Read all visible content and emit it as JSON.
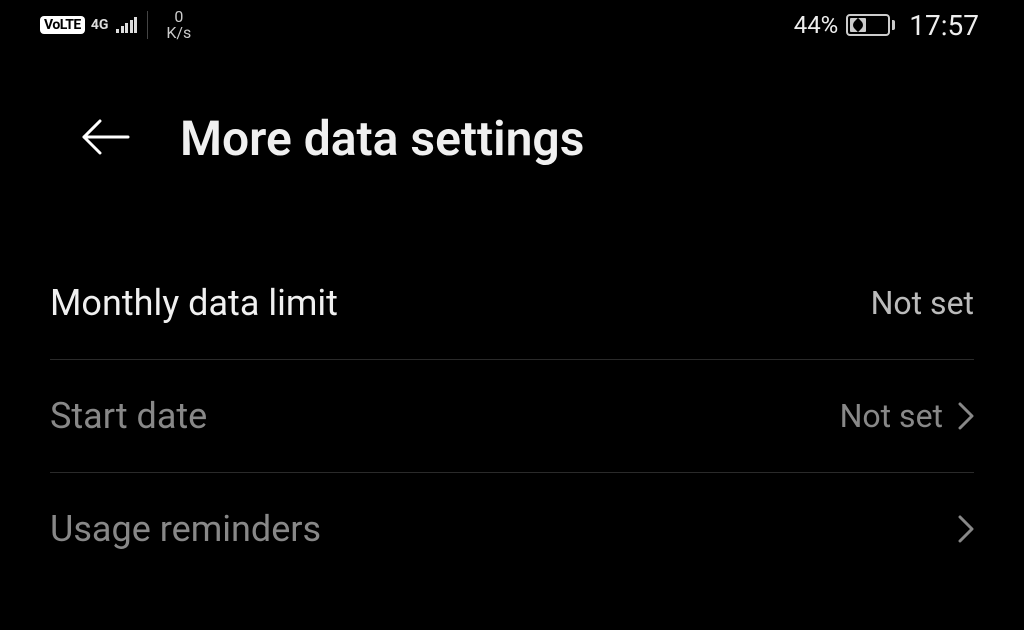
{
  "status_bar": {
    "volte": "VoLTE",
    "network_type": "4G",
    "speed_value": "0",
    "speed_unit": "K/s",
    "battery_percent": "44%",
    "clock": "17:57"
  },
  "header": {
    "title": "More data settings"
  },
  "settings": [
    {
      "label": "Monthly data limit",
      "value": "Not set",
      "chevron": false,
      "active": true
    },
    {
      "label": "Start date",
      "value": "Not set",
      "chevron": true,
      "active": false
    },
    {
      "label": "Usage reminders",
      "value": "",
      "chevron": true,
      "active": false
    }
  ]
}
